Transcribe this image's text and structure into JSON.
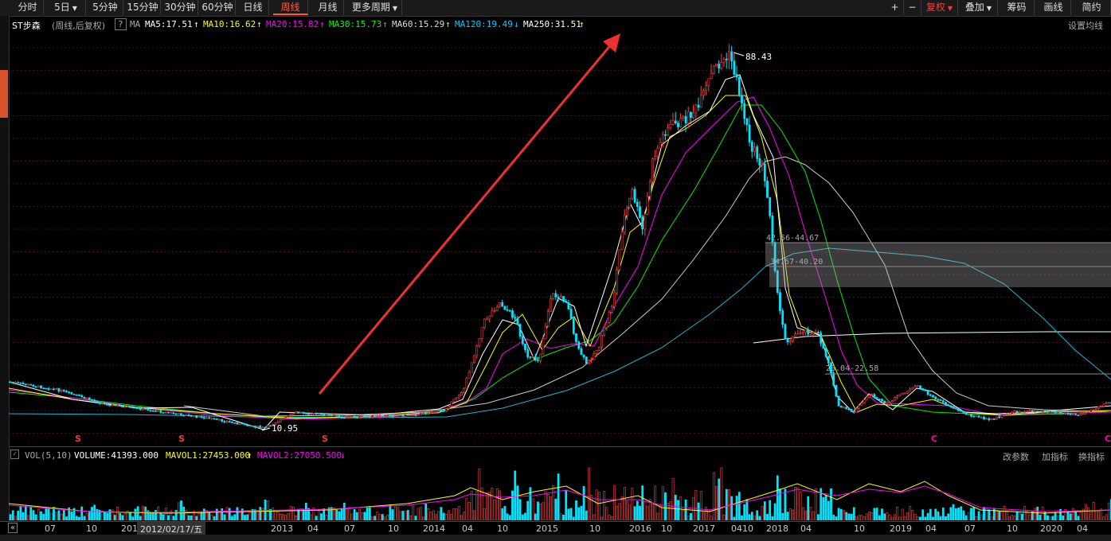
{
  "toolbar": {
    "left": [
      "分时",
      "5日",
      "5分钟",
      "15分钟",
      "30分钟",
      "60分钟",
      "日线",
      "周线",
      "月线",
      "更多周期"
    ],
    "active": "周线",
    "right": [
      "+",
      "−",
      "复权",
      "叠加",
      "筹码",
      "画线",
      "简约"
    ]
  },
  "info": {
    "stock": "ST步森",
    "mode": "(周线,后复权)",
    "help": "?",
    "ma_label": "MA",
    "ma": [
      {
        "label": "MA5:17.51",
        "arrow": "↑",
        "color": "#ffffff"
      },
      {
        "label": "MA10:16.62",
        "arrow": "↑",
        "color": "#ffff00"
      },
      {
        "label": "MA20:15.82",
        "arrow": "↑",
        "color": "#ff00ff"
      },
      {
        "label": "MA30:15.73",
        "arrow": "↑",
        "color": "#00ff00"
      },
      {
        "label": "MA60:15.29",
        "arrow": "↑",
        "color": "#dddddd"
      },
      {
        "label": "MA120:19.49",
        "arrow": "↓",
        "color": "#00ccff"
      },
      {
        "label": "MA250:31.51",
        "arrow": "↑",
        "color": "#ffffff"
      }
    ],
    "settings": "设置均线"
  },
  "annotations": {
    "high": "88.43",
    "low": "10.95",
    "band1": "42.56-44.67",
    "band2": "34.67-40.20",
    "band3": "23.04-22.58",
    "marks": [
      "S",
      "S",
      "S",
      "C",
      "C"
    ]
  },
  "volume": {
    "label": "VOL(5,10)",
    "volume": "VOLUME:41393.000",
    "mavol1": "MAVOL1:27453.000",
    "mavol2": "MAVOL2:27050.500",
    "mavol1_arrow": "↑",
    "mavol2_arrow": "↓",
    "actions": [
      "改参数",
      "加指标",
      "换指标"
    ]
  },
  "dates": {
    "cursor": "2012/02/17/五",
    "ticks": [
      "07",
      "10",
      "201",
      "2013",
      "04",
      "07",
      "10",
      "2014",
      "04",
      "10",
      "2015",
      "10",
      "2016",
      "10",
      "2017",
      "04",
      "10",
      "2018",
      "04",
      "10",
      "2019",
      "04",
      "07",
      "10",
      "2020",
      "04"
    ]
  },
  "colors": {
    "up": "#ff4040",
    "down": "#00e5ff",
    "accent": "#ff5a3c",
    "background": "#000000"
  }
}
